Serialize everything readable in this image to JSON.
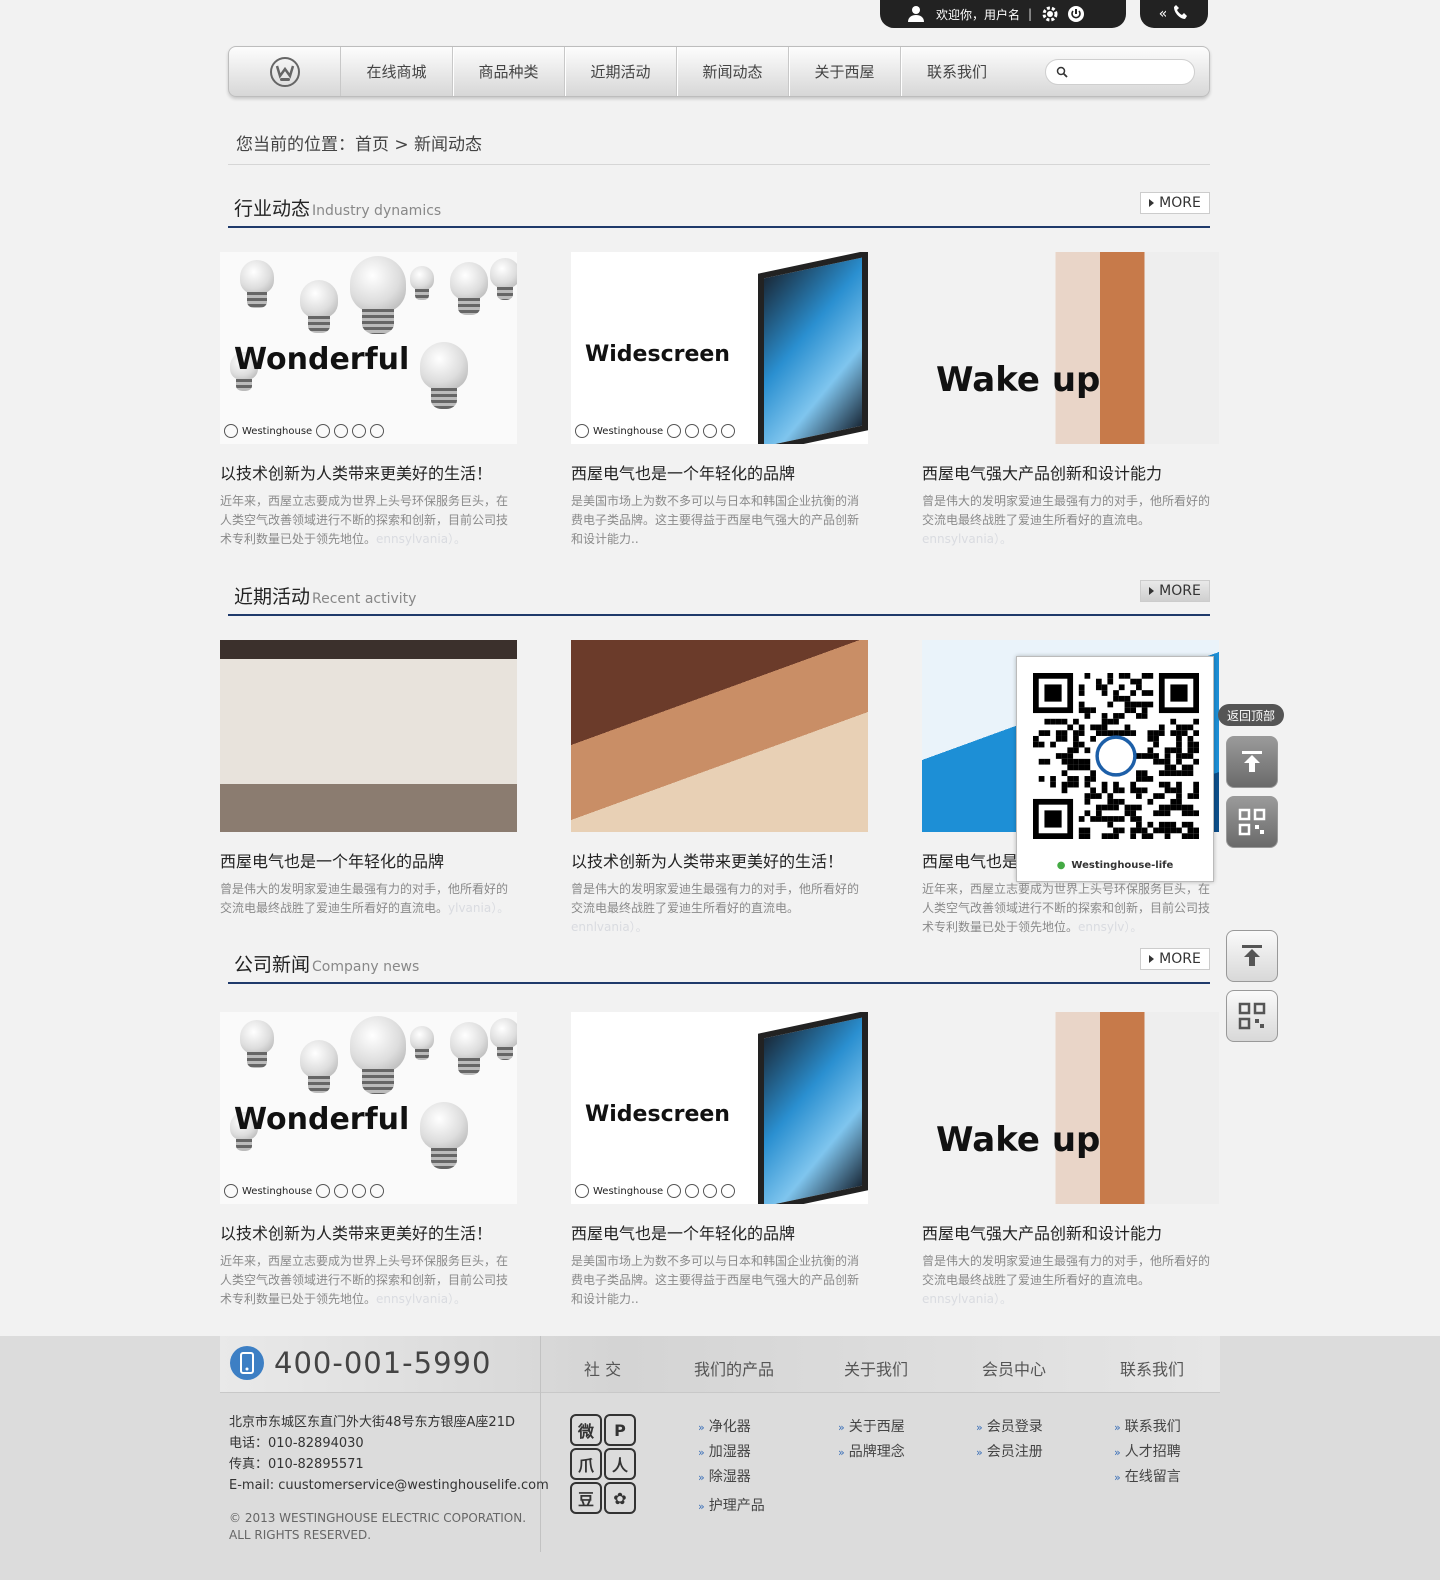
{
  "topbar": {
    "welcome": "欢迎你，用户名",
    "sep": "|"
  },
  "nav": {
    "items": [
      "在线商城",
      "商品种类",
      "近期活动",
      "新闻动态",
      "关于西屋",
      "联系我们"
    ],
    "search_placeholder": ""
  },
  "breadcrumb": "您当前的位置：首页 > 新闻动态",
  "more_label": "MORE",
  "sections": [
    {
      "title_cn": "行业动态",
      "title_en": "Industry dynamics",
      "cards": [
        {
          "image_word": "Wonderful",
          "title": "以技术创新为人类带来更美好的生活！",
          "desc": "近年来，西屋立志要成为世界上头号环保服务巨头，在人类空气改善领域进行不断的探索和创新，目前公司技术专利数量已处于领先地位。",
          "desc_fade": "ennsylvania）。"
        },
        {
          "image_word": "Widescreen",
          "title": "西屋电气也是一个年轻化的品牌",
          "desc": "是美国市场上为数不多可以与日本和韩国企业抗衡的消费电子类品牌。这主要得益于西屋电气强大的产品创新和设计能力..",
          "desc_fade": ""
        },
        {
          "image_word": "Wake up",
          "title": "西屋电气强大产品创新和设计能力",
          "desc": "曾是伟大的发明家爱迪生最强有力的对手，他所看好的交流电最终战胜了爱迪生所看好的直流电。",
          "desc_fade": "ennsylvania）。"
        }
      ]
    },
    {
      "title_cn": "近期活动",
      "title_en": "Recent activity",
      "cards": [
        {
          "image_word": "",
          "title": "西屋电气也是一个年轻化的品牌",
          "desc": "曾是伟大的发明家爱迪生最强有力的对手，他所看好的交流电最终战胜了爱迪生所看好的直流电。",
          "desc_fade": "ylvania）。"
        },
        {
          "image_word": "",
          "title": "以技术创新为人类带来更美好的生活！",
          "desc": "曾是伟大的发明家爱迪生最强有力的对手，他所看好的交流电最终战胜了爱迪生所看好的直流电。",
          "desc_fade": "ennlvania）。"
        },
        {
          "image_word": "",
          "title": "西屋电气也是",
          "desc": "近年来，西屋立志要成为世界上头号环保服务巨头，在人类空气改善领域进行不断的探索和创新，目前公司技术专利数量已处于领先地位。",
          "desc_fade": "ennsylv）。"
        }
      ]
    },
    {
      "title_cn": "公司新闻",
      "title_en": "Company news",
      "cards": [
        {
          "image_word": "Wonderful",
          "title": "以技术创新为人类带来更美好的生活！",
          "desc": "近年来，西屋立志要成为世界上头号环保服务巨头，在人类空气改善领域进行不断的探索和创新，目前公司技术专利数量已处于领先地位。",
          "desc_fade": "ennsylvania）。"
        },
        {
          "image_word": "Widescreen",
          "title": "西屋电气也是一个年轻化的品牌",
          "desc": "是美国市场上为数不多可以与日本和韩国企业抗衡的消费电子类品牌。这主要得益于西屋电气强大的产品创新和设计能力..",
          "desc_fade": ""
        },
        {
          "image_word": "Wake up",
          "title": "西屋电气强大产品创新和设计能力",
          "desc": "曾是伟大的发明家爱迪生最强有力的对手，他所看好的交流电最终战胜了爱迪生所看好的直流电。",
          "desc_fade": "ennsylvania）。"
        }
      ]
    }
  ],
  "brand_caption": "Westinghouse",
  "qr": {
    "caption": "Westinghouse-life"
  },
  "side": {
    "back_top": "返回顶部"
  },
  "footer": {
    "phone": "400-001-5990",
    "col_heads": [
      "社 交",
      "我们的产品",
      "关于我们",
      "会员中心",
      "联系我们"
    ],
    "address": "北京市东城区东直门外大街48号东方银座A座21D",
    "tel": "电话：010-82894030",
    "fax": "传真：010-82895571",
    "email": "E-mail: cuustomerservice@westinghouselife.com",
    "copy1": "© 2013 WESTINGHOUSE ELECTRIC COPORATION.",
    "copy2": "ALL RIGHTS RESERVED.",
    "social": [
      "微",
      "P",
      "爪",
      "人",
      "豆",
      "✿"
    ],
    "products": [
      "净化器",
      "加湿器",
      "除湿器",
      "护理产品"
    ],
    "about": [
      "关于西屋",
      "品牌理念"
    ],
    "member": [
      "会员登录",
      "会员注册"
    ],
    "contact": [
      "联系我们",
      "人才招聘",
      "在线留言"
    ]
  },
  "colors": {
    "accent_line": "#1f3a6b",
    "phone_icon": "#3d7fc4",
    "bar_dark": "#222222"
  }
}
